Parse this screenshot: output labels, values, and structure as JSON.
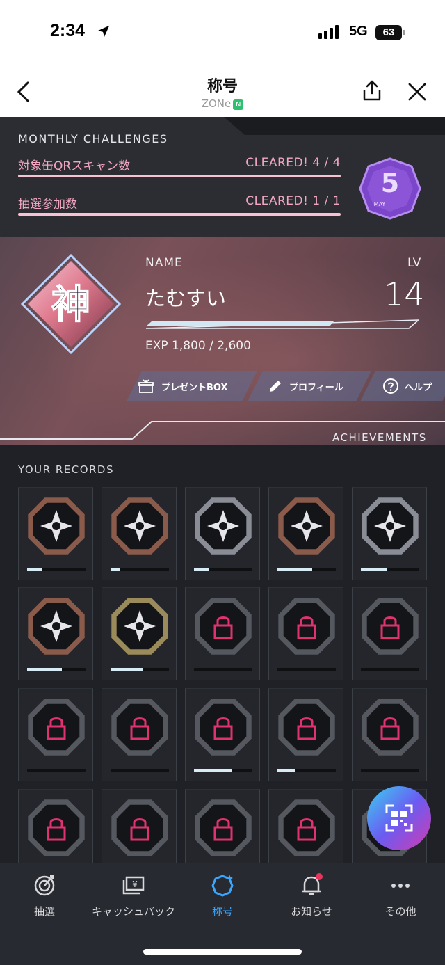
{
  "status_bar": {
    "time": "2:34",
    "network": "5G",
    "battery": "63"
  },
  "header": {
    "title": "称号",
    "subtitle": "ZONe",
    "subtitle_badge": "N"
  },
  "monthly": {
    "title": "MONTHLY CHALLENGES",
    "rows": [
      {
        "label": "対象缶QRスキャン数",
        "status": "CLEARED!  4 / 4"
      },
      {
        "label": "抽選参加数",
        "status": "CLEARED!  1 / 1"
      }
    ],
    "medal": {
      "number": "5",
      "month": "MAY"
    }
  },
  "profile": {
    "avatar_kanji": "神",
    "name_label": "NAME",
    "name": "たむすい",
    "lv_label": "LV",
    "level": "14",
    "exp_text": "EXP 1,800 / 2,600",
    "exp_progress": 0.69
  },
  "actions": [
    {
      "label": "プレゼントBOX",
      "icon": "gift-icon"
    },
    {
      "label": "プロフィール",
      "icon": "pencil-icon"
    },
    {
      "label": "ヘルプ",
      "icon": "help-icon"
    }
  ],
  "sections": {
    "achievements": "ACHIEVEMENTS",
    "records": "YOUR RECORDS"
  },
  "records": [
    {
      "icon": "star-burst-icon",
      "locked": false,
      "tier": "bronze",
      "progress": 0.25
    },
    {
      "icon": "spiral-icon",
      "locked": false,
      "tier": "bronze",
      "progress": 0.15
    },
    {
      "icon": "vault-icon",
      "locked": false,
      "tier": "silver",
      "progress": 0.25
    },
    {
      "icon": "city-icon",
      "locked": false,
      "tier": "bronze",
      "progress": 0.6
    },
    {
      "icon": "lightning-fist-icon",
      "locked": false,
      "tier": "silver",
      "progress": 0.45
    },
    {
      "icon": "wolf-icon",
      "locked": false,
      "tier": "bronze",
      "progress": 0.6
    },
    {
      "icon": "web-icon",
      "locked": false,
      "tier": "gold",
      "progress": 0.55
    },
    {
      "icon": "locked-icon",
      "locked": true,
      "tier": "locked",
      "progress": 0
    },
    {
      "icon": "locked-icon",
      "locked": true,
      "tier": "locked",
      "progress": 0
    },
    {
      "icon": "locked-icon",
      "locked": true,
      "tier": "locked",
      "progress": 0
    },
    {
      "icon": "locked-icon",
      "locked": true,
      "tier": "locked",
      "progress": 0
    },
    {
      "icon": "locked-icon",
      "locked": true,
      "tier": "locked",
      "progress": 0
    },
    {
      "icon": "locked-icon",
      "locked": true,
      "tier": "locked",
      "progress": 0.65
    },
    {
      "icon": "locked-icon",
      "locked": true,
      "tier": "locked",
      "progress": 0.3
    },
    {
      "icon": "locked-icon",
      "locked": true,
      "tier": "locked",
      "progress": 0
    },
    {
      "icon": "locked-icon",
      "locked": true,
      "tier": "locked",
      "progress": 0
    },
    {
      "icon": "locked-icon",
      "locked": true,
      "tier": "locked",
      "progress": 0
    },
    {
      "icon": "locked-icon",
      "locked": true,
      "tier": "locked",
      "progress": 0
    },
    {
      "icon": "locked-icon",
      "locked": true,
      "tier": "locked",
      "progress": 0
    },
    {
      "icon": "locked-icon",
      "locked": true,
      "tier": "locked",
      "progress": 0
    }
  ],
  "tabs": [
    {
      "label": "抽選",
      "icon": "target-icon",
      "active": false
    },
    {
      "label": "キャッシュバック",
      "icon": "cashback-icon",
      "active": false
    },
    {
      "label": "称号",
      "icon": "badge-icon",
      "active": true
    },
    {
      "label": "お知らせ",
      "icon": "bell-icon",
      "active": false,
      "dot": true
    },
    {
      "label": "その他",
      "icon": "more-icon",
      "active": false
    }
  ],
  "colors": {
    "accent_blue": "#39a7ff",
    "challenge_pink": "#f2a6c0",
    "bronze": "#8a5a4a",
    "silver": "#8a8d96",
    "gold": "#9b8a5a",
    "lock_pink": "#e0326e"
  }
}
